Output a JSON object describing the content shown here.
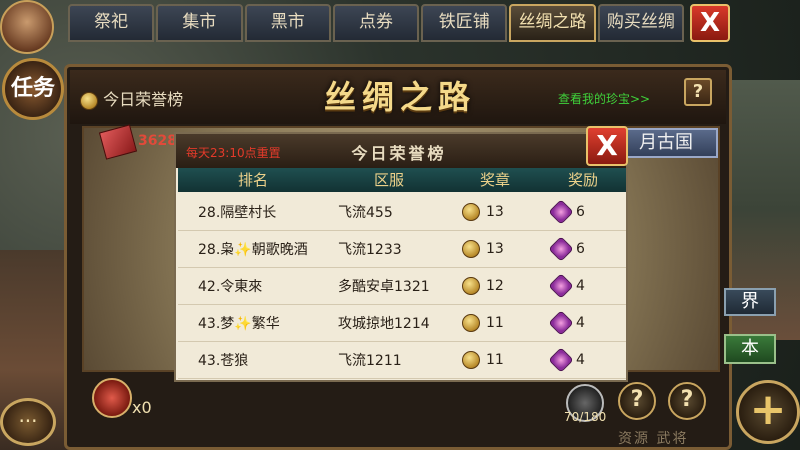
{
  "tabs": [
    {
      "label": "祭祀",
      "active": false
    },
    {
      "label": "集市",
      "active": false
    },
    {
      "label": "黑市",
      "active": false
    },
    {
      "label": "点券",
      "active": false
    },
    {
      "label": "铁匠铺",
      "active": false
    },
    {
      "label": "丝绸之路",
      "active": true
    },
    {
      "label": "购买丝绸",
      "active": false
    }
  ],
  "close_label": "X",
  "side_button_label": "任务",
  "panel": {
    "title": "丝绸之路",
    "honor_link": "今日荣誉榜",
    "treasure_link": "查看我的珍宝>>",
    "help_label": "?"
  },
  "map": {
    "red_count": "3628",
    "country_label": "月古国",
    "world_label": "界",
    "ben_label": "本",
    "bottom_text": "资源  武将"
  },
  "honor_popup": {
    "reset_text": "每天23:10点重置",
    "title": "今日荣誉榜",
    "close_label": "X",
    "headers": [
      "排名",
      "区服",
      "奖章",
      "奖励"
    ],
    "rows": [
      {
        "rank_name": "28.隔壁村长",
        "server": "飞流455",
        "medals": "13",
        "reward": "6"
      },
      {
        "rank_name": "28.枭✨朝歌晚酒",
        "server": "飞流1233",
        "medals": "13",
        "reward": "6"
      },
      {
        "rank_name": "42.令東來",
        "server": "多酷安卓1321",
        "medals": "12",
        "reward": "4"
      },
      {
        "rank_name": "43.梦✨繁华",
        "server": "攻城掠地1214",
        "medals": "11",
        "reward": "4"
      },
      {
        "rank_name": "43.苍狼",
        "server": "飞流1211",
        "medals": "11",
        "reward": "4"
      }
    ]
  },
  "bottom": {
    "medal_count": "x0",
    "capacity": "70/180",
    "help_labels": [
      "?",
      "?"
    ],
    "chat_label": "···",
    "plus_label": "+"
  },
  "colors": {
    "accent_gold": "#c9a660",
    "close_red": "#d8392a",
    "link_green": "#3fd03a",
    "reset_red": "#e33a2a"
  }
}
